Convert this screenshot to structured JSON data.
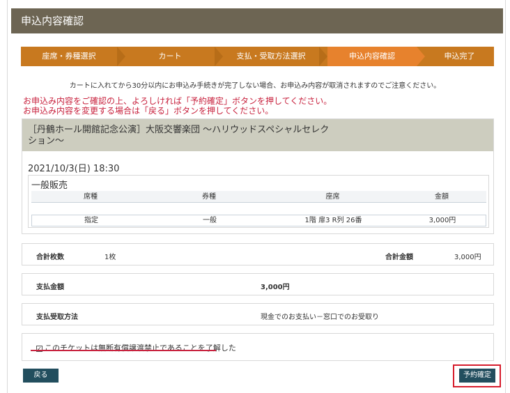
{
  "page": {
    "title": "申込内容確認"
  },
  "steps": [
    {
      "label": "座席・券種選択",
      "active": false
    },
    {
      "label": "カート",
      "active": false
    },
    {
      "label": "支払・受取方法選択",
      "active": false
    },
    {
      "label": "申込内容確認",
      "active": true
    },
    {
      "label": "申込完了",
      "active": false
    }
  ],
  "notice": "カートに入れてから30分以内にお申込み手続きが完了しない場合、お申込み内容が取消されますのでご注意ください。",
  "warnings": [
    "お申込み内容をご確認の上、よろしければ「予約確定」ボタンを押してください。",
    "お申込み内容を変更する場合は「戻る」ボタンを押してください。"
  ],
  "event": {
    "title_line1": "［丹鶴ホール開館記念公演］大阪交響楽団 〜ハリウッドスペシャルセレク",
    "title_line2": "ション〜",
    "datetime": "2021/10/3(日) 18:30",
    "sale_type": "一般販売",
    "table": {
      "headers": [
        "席種",
        "券種",
        "座席",
        "金額"
      ],
      "rows": [
        [
          "指定",
          "一般",
          "1階 扉3 R列 26番",
          "3,000円"
        ]
      ]
    }
  },
  "summary": {
    "count_label": "合計枚数",
    "count_value": "1枚",
    "total_label": "合計金額",
    "total_value": "3,000円",
    "payment_amount_label": "支払金額",
    "payment_amount_value": "3,000円",
    "method_label": "支払受取方法",
    "method_value": "現金でのお支払い－窓口でのお受取り"
  },
  "agreement": {
    "checked": true,
    "label": "このチケットは無断有償譲渡禁止であることを了解した"
  },
  "buttons": {
    "back": "戻る",
    "confirm": "予約確定"
  },
  "colors": {
    "title_bar": "#6d6553",
    "step_bar": "#c8791f",
    "step_active": "#e7822d",
    "warning_text": "#c8223e",
    "button": "#224e5e",
    "highlight": "#d61c2c"
  }
}
